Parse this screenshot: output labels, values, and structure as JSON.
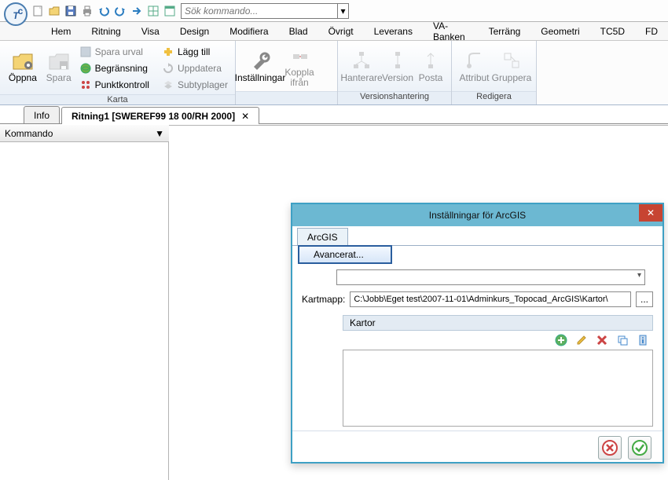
{
  "qat": {
    "search_placeholder": "Sök kommando..."
  },
  "menu": {
    "items": [
      "Hem",
      "Ritning",
      "Visa",
      "Design",
      "Modifiera",
      "Blad",
      "Övrigt",
      "Leverans",
      "VA-Banken",
      "Terräng",
      "Geometri",
      "TC5D",
      "FD"
    ]
  },
  "ribbon": {
    "group_karta": "Karta",
    "group_vers": "Versionshantering",
    "group_redig": "Redigera",
    "open": "Öppna",
    "save": "Spara",
    "spara_urval": "Spara urval",
    "begransning": "Begränsning",
    "punktkontroll": "Punktkontroll",
    "lagg_till": "Lägg till",
    "uppdatera": "Uppdatera",
    "subtyplager": "Subtyplager",
    "installningar": "Inställningar",
    "koppla": "Koppla ifrån",
    "hanterare": "Hanterare",
    "version": "Version",
    "posta": "Posta",
    "attribut": "Attribut",
    "gruppera": "Gruppera"
  },
  "tabs": {
    "info": "Info",
    "ritning": "Ritning1 [SWEREF99 18 00/RH 2000]"
  },
  "panel": {
    "kommando": "Kommando"
  },
  "dialog": {
    "title": "Inställningar för ArcGIS",
    "tab_arcgis": "ArcGIS",
    "advanced": "Avancerat...",
    "kartmapp_label": "Kartmapp:",
    "kartmapp_value": "C:\\Jobb\\Eget test\\2007-11-01\\Adminkurs_Topocad_ArcGIS\\Kartor\\",
    "browse": "...",
    "kartor_header": "Kartor"
  }
}
